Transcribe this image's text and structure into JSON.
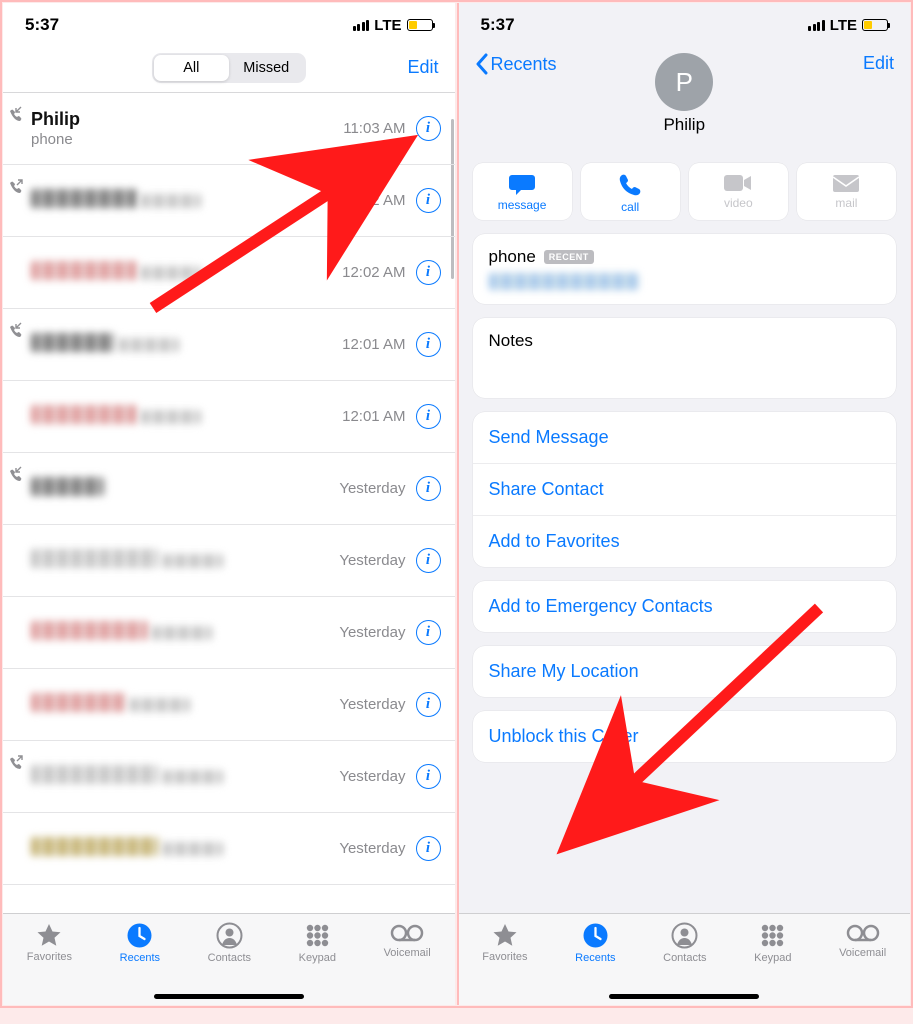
{
  "status": {
    "time": "5:37",
    "net": "LTE"
  },
  "left": {
    "seg_all": "All",
    "seg_missed": "Missed",
    "edit": "Edit",
    "rows": [
      {
        "name": "Philip",
        "sub": "phone",
        "time": "11:03 AM",
        "name_px": "",
        "sub_px": "",
        "icon": "incoming"
      },
      {
        "name": "██████",
        "sub": "████",
        "time": "12:02 AM",
        "name_px": "px-dark",
        "sub_px": "pixelate",
        "icon": "outgoing"
      },
      {
        "name": "██████",
        "sub": "████",
        "time": "12:02 AM",
        "name_px": "px-red",
        "sub_px": "pixelate",
        "icon": ""
      },
      {
        "name": "████",
        "sub": "████",
        "time": "12:01 AM",
        "name_px": "px-dark",
        "sub_px": "pixelate",
        "icon": "incoming"
      },
      {
        "name": "██████",
        "sub": "████",
        "time": "12:01 AM",
        "name_px": "px-red",
        "sub_px": "pixelate",
        "icon": ""
      },
      {
        "name": "███",
        "sub": "",
        "time": "Yesterday",
        "name_px": "px-dark",
        "sub_px": "",
        "icon": "incoming"
      },
      {
        "name": "████████",
        "sub": "███",
        "time": "Yesterday",
        "name_px": "pixelate",
        "sub_px": "pixelate",
        "icon": ""
      },
      {
        "name": "███████",
        "sub": "███",
        "time": "Yesterday",
        "name_px": "px-red",
        "sub_px": "pixelate",
        "icon": ""
      },
      {
        "name": "█████",
        "sub": "███",
        "time": "Yesterday",
        "name_px": "px-red",
        "sub_px": "pixelate",
        "icon": ""
      },
      {
        "name": "████████",
        "sub": "███",
        "time": "Yesterday",
        "name_px": "pixelate",
        "sub_px": "pixelate",
        "icon": "outgoing"
      },
      {
        "name": "████████",
        "sub": "███",
        "time": "Yesterday",
        "name_px": "px-gold",
        "sub_px": "pixelate",
        "icon": ""
      }
    ]
  },
  "right": {
    "back": "Recents",
    "edit": "Edit",
    "avatar_initial": "P",
    "name": "Philip",
    "actions": [
      {
        "id": "message",
        "label": "message",
        "en": true
      },
      {
        "id": "call",
        "label": "call",
        "en": true
      },
      {
        "id": "video",
        "label": "video",
        "en": false
      },
      {
        "id": "mail",
        "label": "mail",
        "en": false
      }
    ],
    "phone_label": "phone",
    "recent_tag": "RECENT",
    "notes_label": "Notes",
    "menu1": [
      "Send Message",
      "Share Contact",
      "Add to Favorites"
    ],
    "menu2": [
      "Add to Emergency Contacts"
    ],
    "menu3": [
      "Share My Location"
    ],
    "menu4": [
      "Unblock this Caller"
    ]
  },
  "tabs": [
    {
      "id": "favorites",
      "label": "Favorites"
    },
    {
      "id": "recents",
      "label": "Recents"
    },
    {
      "id": "contacts",
      "label": "Contacts"
    },
    {
      "id": "keypad",
      "label": "Keypad"
    },
    {
      "id": "voicemail",
      "label": "Voicemail"
    }
  ]
}
